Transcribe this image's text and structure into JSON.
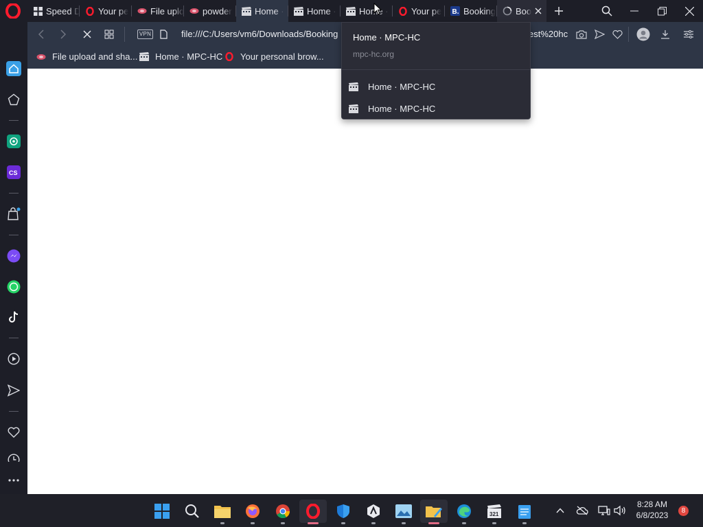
{
  "tabs": [
    {
      "title": "Speed D",
      "icon": "grid-icon"
    },
    {
      "title": "Your pe",
      "icon": "opera-icon"
    },
    {
      "title": "File uplo",
      "icon": "file-upload-icon"
    },
    {
      "title": "powder",
      "icon": "file-upload-icon"
    },
    {
      "title": "Home ·",
      "icon": "mpc-hc-icon"
    },
    {
      "title": "Home ·",
      "icon": "mpc-hc-icon"
    },
    {
      "title": "Home ·",
      "icon": "mpc-hc-icon"
    },
    {
      "title": "Your pe",
      "icon": "opera-icon"
    },
    {
      "title": "Booking",
      "icon": "booking-icon"
    },
    {
      "title": "Boo",
      "icon": "loading-spinner-icon"
    }
  ],
  "toolbar": {
    "vpn_label": "VPN",
    "url_left": "file:///C:/Users/vm6/Downloads/Booking",
    "url_right": "est%20hc"
  },
  "bookmarks": [
    {
      "label": "File upload and sha...",
      "icon": "file-upload-icon"
    },
    {
      "label": "Home · MPC-HC",
      "icon": "mpc-hc-icon"
    },
    {
      "label": "Your personal brow...",
      "icon": "opera-icon"
    }
  ],
  "popup": {
    "title": "Home · MPC-HC",
    "url": "mpc-hc.org",
    "items": [
      {
        "label": "Home · MPC-HC"
      },
      {
        "label": "Home · MPC-HC"
      }
    ]
  },
  "taskbar": {
    "time": "8:28 AM",
    "date": "6/8/2023",
    "notification_count": "8"
  },
  "colors": {
    "chrome_bg": "#1d1e27",
    "toolbar_bg": "#2e3646",
    "accent": "#e0463f",
    "content_bg": "#ffffff"
  }
}
